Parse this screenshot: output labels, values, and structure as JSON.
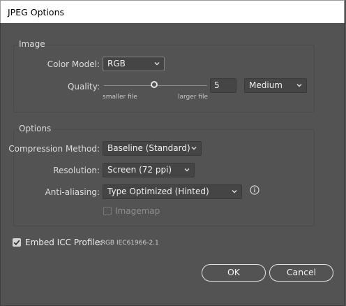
{
  "window": {
    "title": "JPEG Options"
  },
  "image_group": {
    "title": "Image",
    "color_model": {
      "label": "Color Model:",
      "value": "RGB"
    },
    "quality": {
      "label": "Quality:",
      "level": 5,
      "preset": "Medium",
      "min_label": "smaller file",
      "max_label": "larger file"
    }
  },
  "options_group": {
    "title": "Options",
    "compression": {
      "label": "Compression Method:",
      "value": "Baseline (Standard)"
    },
    "resolution": {
      "label": "Resolution:",
      "value": "Screen (72 ppi)"
    },
    "antialiasing": {
      "label": "Anti-aliasing:",
      "value": "Type Optimized (Hinted)"
    },
    "imagemap": {
      "label": "Imagemap",
      "checked": false,
      "enabled": false
    }
  },
  "icc": {
    "label": "Embed ICC Profile:",
    "value": "sRGB IEC61966-2.1",
    "checked": true
  },
  "buttons": {
    "ok": "OK",
    "cancel": "Cancel"
  },
  "colors": {
    "accent": "#4a90d9",
    "panel": "#535353",
    "field": "#454545"
  }
}
